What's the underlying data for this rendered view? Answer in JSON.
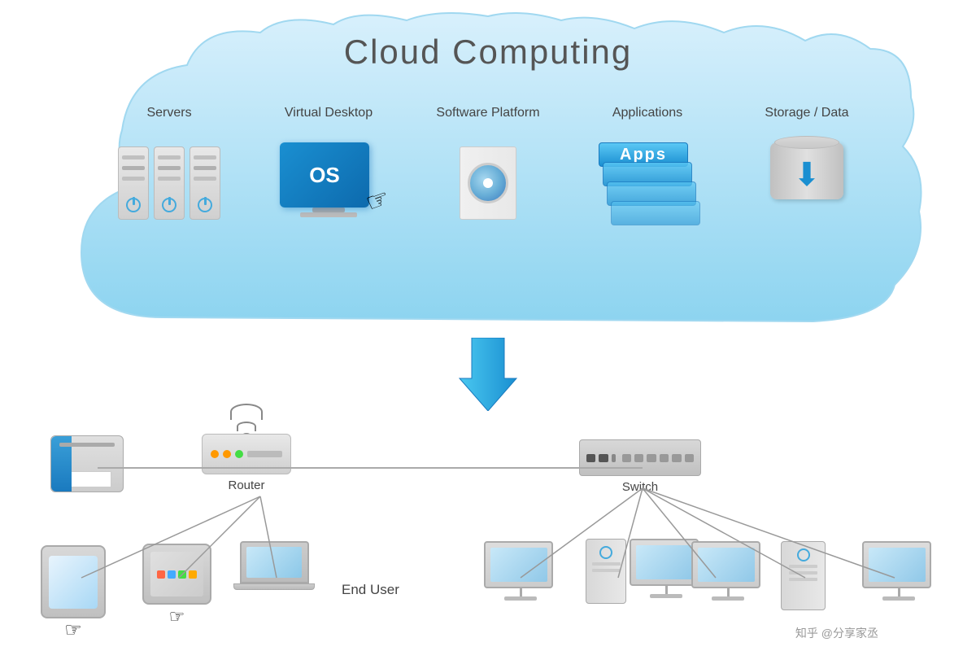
{
  "title": "Cloud Computing",
  "cloud": {
    "items": [
      {
        "id": "servers",
        "label": "Servers"
      },
      {
        "id": "virtual-desktop",
        "label": "Virtual Desktop"
      },
      {
        "id": "software-platform",
        "label": "Software Platform"
      },
      {
        "id": "applications",
        "label": "Applications"
      },
      {
        "id": "storage-data",
        "label": "Storage / Data"
      }
    ]
  },
  "network": {
    "router_label": "Router",
    "switch_label": "Switch",
    "end_user_label": "End User",
    "printer_label": "",
    "tablet_label": ""
  },
  "watermark": "知乎 @分享家丞",
  "colors": {
    "cloud_blue": "#5bc8f5",
    "cloud_dark_blue": "#1a8fd1",
    "cloud_bg": "#b8e8f8",
    "arrow_blue": "#1a8fd1",
    "text_dark": "#444444"
  }
}
